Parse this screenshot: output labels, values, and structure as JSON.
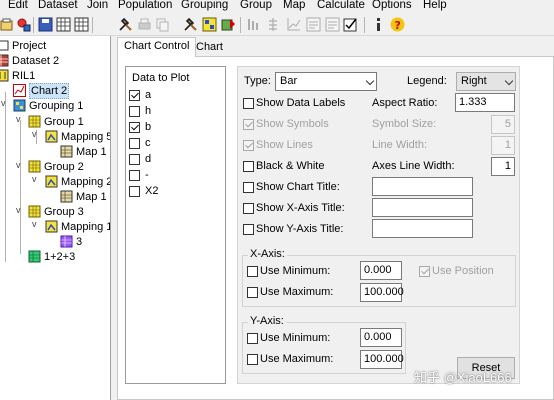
{
  "menubar": [
    "Edit",
    "Dataset",
    "Join",
    "Population",
    "Grouping",
    "Group",
    "Map",
    "Calculate",
    "Options",
    "Help"
  ],
  "toolbar": {
    "icons": [
      "tool-1-icon",
      "tool-2-icon",
      "save-icon",
      "grid-icon",
      "tools-icon",
      "print-icon",
      "copy-icon",
      "checked-window-icon",
      "grouping-icon",
      "run-icon",
      "sort-icon",
      "align-icon",
      "chart-icon",
      "list-icon",
      "checkbox-icon",
      "info-icon",
      "help-icon"
    ]
  },
  "tree": [
    {
      "label": "Project",
      "icon": "project-icon"
    },
    {
      "label": "Dataset 2",
      "icon": "dataset-icon"
    },
    {
      "label": "RIL1",
      "icon": "population-icon"
    },
    {
      "label": "Chart 2",
      "icon": "chart-icon",
      "selected": true
    },
    {
      "label": "Grouping 1",
      "icon": "grouping-icon"
    },
    {
      "label": "Group 1",
      "icon": "group-icon"
    },
    {
      "label": "Mapping 5",
      "icon": "mapping-icon"
    },
    {
      "label": "Map 1",
      "icon": "map-icon"
    },
    {
      "label": "Group 2",
      "icon": "group-icon"
    },
    {
      "label": "Mapping 2",
      "icon": "mapping-icon"
    },
    {
      "label": "Map 1",
      "icon": "map-icon"
    },
    {
      "label": "Group 3",
      "icon": "group-icon"
    },
    {
      "label": "Mapping 1",
      "icon": "mapping-icon"
    },
    {
      "label": "3",
      "icon": "map-purple-icon"
    },
    {
      "label": "1+2+3",
      "icon": "join-icon"
    }
  ],
  "tabs": [
    {
      "label": "Chart Control",
      "active": true
    },
    {
      "label": "Chart",
      "active": false
    }
  ],
  "data_to_plot": {
    "title": "Data to Plot",
    "items": [
      {
        "label": "a",
        "checked": true
      },
      {
        "label": "h",
        "checked": false
      },
      {
        "label": "b",
        "checked": true
      },
      {
        "label": "c",
        "checked": false
      },
      {
        "label": "d",
        "checked": false
      },
      {
        "label": "-",
        "checked": false
      },
      {
        "label": "X2",
        "checked": false
      }
    ]
  },
  "options": {
    "type_label": "Type:",
    "type_value": "Bar",
    "legend_label": "Legend:",
    "legend_value": "Right",
    "show_data_labels": "Show Data Labels",
    "aspect_ratio_label": "Aspect Ratio:",
    "aspect_ratio_value": "1.333",
    "show_symbols": "Show Symbols",
    "symbol_size_label": "Symbol Size:",
    "symbol_size_value": "5",
    "show_lines": "Show Lines",
    "line_width_label": "Line Width:",
    "line_width_value": "1",
    "black_white": "Black & White",
    "axes_line_width_label": "Axes Line Width:",
    "axes_line_width_value": "1",
    "show_chart_title": "Show Chart Title:",
    "chart_title_value": "",
    "show_x_title": "Show X-Axis Title:",
    "x_title_value": "",
    "show_y_title": "Show Y-Axis Title:",
    "y_title_value": ""
  },
  "x_axis": {
    "title": "X-Axis:",
    "use_min": "Use Minimum:",
    "min_value": "0.000",
    "use_max": "Use Maximum:",
    "max_value": "100.000",
    "use_position": "Use Position"
  },
  "y_axis": {
    "title": "Y-Axis:",
    "use_min": "Use Minimum:",
    "min_value": "0.000",
    "use_max": "Use Maximum:",
    "max_value": "100.000"
  },
  "reset_label": "Reset",
  "watermark": "知乎 @XiaoL666"
}
